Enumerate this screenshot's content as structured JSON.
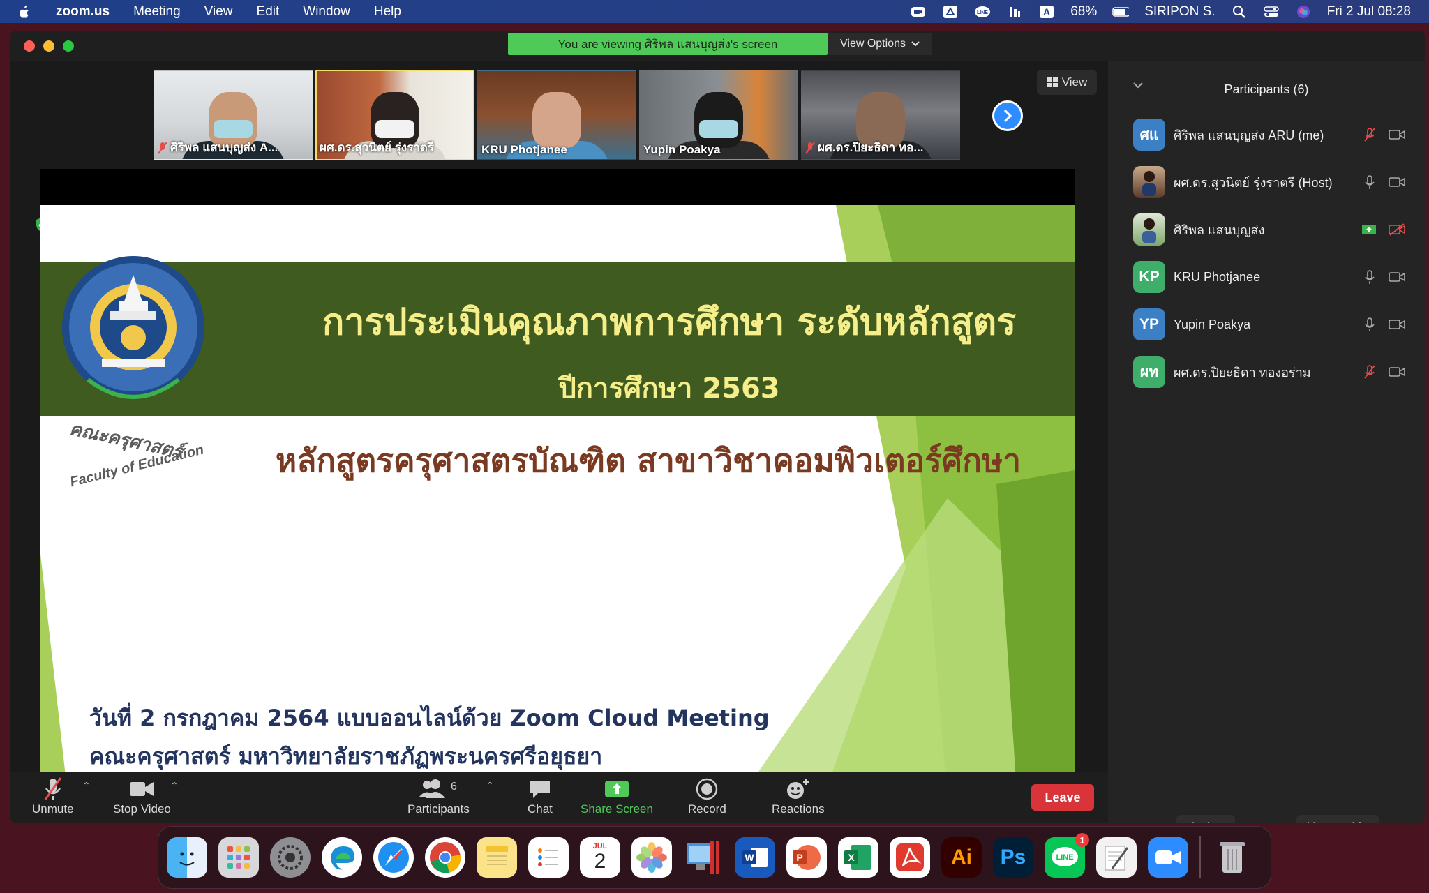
{
  "menubar": {
    "app_name": "zoom.us",
    "items": [
      "Meeting",
      "View",
      "Edit",
      "Window",
      "Help"
    ],
    "battery": "68%",
    "user": "SIRIPON S.",
    "clock": "Fri 2 Jul  08:28"
  },
  "window": {
    "viewing_banner": "You are viewing ศิริพล แสนบุญส่ง's screen",
    "view_options": "View Options",
    "view_button": "View"
  },
  "thumbnails": [
    {
      "label": "ศิริพล แสนบุญส่ง A...",
      "muted": true
    },
    {
      "label": "ผศ.ดร.สุวนิตย์ รุ่งราตรี",
      "muted": false
    },
    {
      "label": "KRU Photjanee",
      "muted": false
    },
    {
      "label": "Yupin Poakya",
      "muted": false
    },
    {
      "label": "ผศ.ดร.ปิยะธิดา ทอ...",
      "muted": true
    }
  ],
  "slide": {
    "title": "การประเมินคุณภาพการศึกษา ระดับหลักสูตร",
    "year": "ปีการศึกษา 2563",
    "program": "หลักสูตรครุศาสตรบัณฑิต สาขาวิชาคอมพิวเตอร์ศึกษา",
    "date_line": "วันที่ 2 กรกฎาคม 2564 แบบออนไลน์ด้วย Zoom Cloud Meeting",
    "faculty_line": "คณะครุศาสตร์ มหาวิทยาลัยราชภัฏพระนครศรีอยุธยา",
    "logo_text": "คณะครุศาสตร์",
    "logo_subtext": "Faculty of Education"
  },
  "participants": {
    "header": "Participants (6)",
    "list": [
      {
        "initials": "ศแ",
        "name": "ศิริพล แสนบุญส่ง ARU (me)",
        "color": "#3b7fc4"
      },
      {
        "initials": "",
        "name": "ผศ.ดร.สุวนิตย์ รุ่งราตรี (Host)",
        "color": "#7a5a40"
      },
      {
        "initials": "",
        "name": "ศิริพล แสนบุญส่ง",
        "color": "#5b8a5a"
      },
      {
        "initials": "KP",
        "name": "KRU Photjanee",
        "color": "#3fae6b"
      },
      {
        "initials": "YP",
        "name": "Yupin Poakya",
        "color": "#3b7fc4"
      },
      {
        "initials": "ผท",
        "name": "ผศ.ดร.ปิยะธิดา ทองอร่าม",
        "color": "#3fae6b"
      }
    ],
    "invite": "Invite",
    "unmute_me": "Unmute Me"
  },
  "toolbar": {
    "unmute": "Unmute",
    "stop_video": "Stop Video",
    "participants": "Participants",
    "participants_count": "6",
    "chat": "Chat",
    "share_screen": "Share Screen",
    "record": "Record",
    "reactions": "Reactions",
    "leave": "Leave"
  },
  "dock": {
    "line_badge": "1",
    "calendar_month": "JUL",
    "calendar_day": "2",
    "illustrator": "Ai",
    "photoshop": "Ps",
    "line": "LINE"
  },
  "colors": {
    "zoom_blue": "#2d8cff",
    "share_green": "#4fc957",
    "leave_red": "#d8343a",
    "slide_band": "#3f5b1f"
  }
}
